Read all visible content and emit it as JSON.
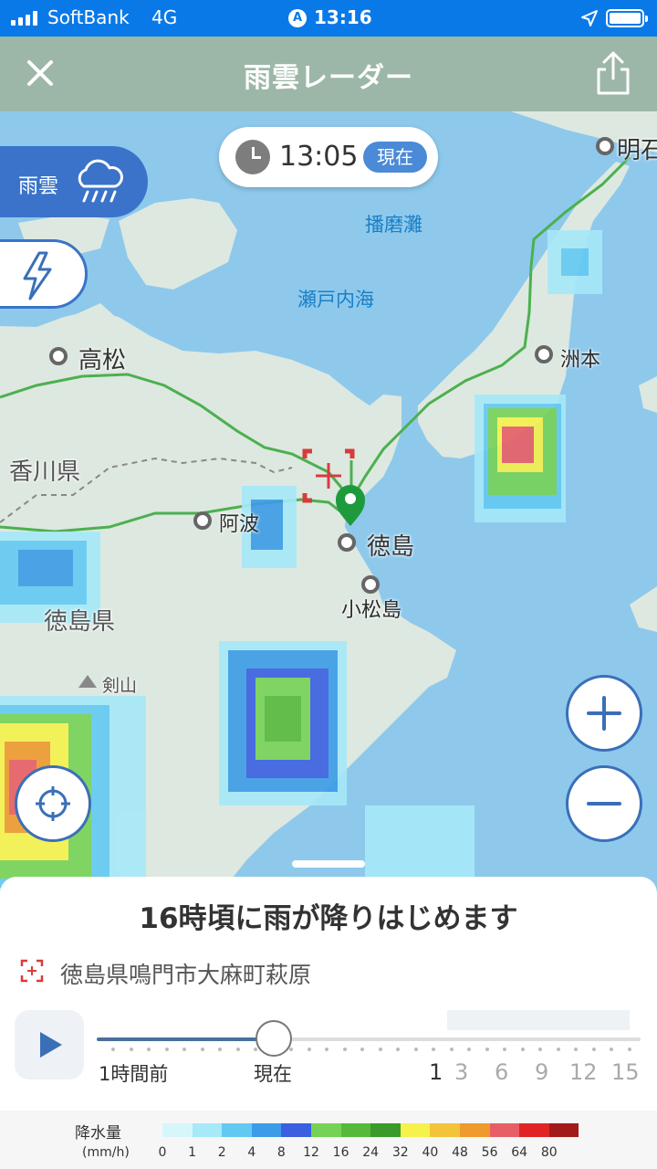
{
  "status_bar": {
    "carrier": "SoftBank",
    "network": "4G",
    "time": "13:16"
  },
  "header": {
    "title": "雨雲レーダー"
  },
  "map": {
    "time": "13:05",
    "now_badge": "現在",
    "layer_rain_label": "雨雲",
    "labels": {
      "harima_nada": "播磨灘",
      "setonaikai": "瀬戸内海",
      "akashi": "明石",
      "takamatsu": "高松",
      "sumoto": "洲本",
      "kagawa": "香川県",
      "awa": "阿波",
      "tokushima": "徳島",
      "komatsushima": "小松島",
      "tokushima_pref": "徳島県",
      "tsurugisan": "剣山"
    }
  },
  "forecast": {
    "headline": "16時頃に雨が降りはじめます",
    "location": "徳島県鳴門市大麻町萩原",
    "timeline": {
      "label_past": "1時間前",
      "label_now": "現在",
      "hours": [
        "1",
        "3",
        "6",
        "9",
        "12",
        "15"
      ],
      "progress": 0.325
    }
  },
  "legend": {
    "title": "降水量",
    "unit": "(mm/h)",
    "values": [
      "0",
      "1",
      "2",
      "4",
      "8",
      "12",
      "16",
      "24",
      "32",
      "40",
      "48",
      "56",
      "64",
      "80"
    ],
    "colors": [
      "#d7f6fc",
      "#a6e9f9",
      "#63c9f2",
      "#3c9ce7",
      "#3a5fe0",
      "#76d256",
      "#55b93a",
      "#3a9b2b",
      "#f6f24b",
      "#f3c43a",
      "#ee9a2d",
      "#e85e66",
      "#e02424",
      "#a31a1a"
    ]
  }
}
